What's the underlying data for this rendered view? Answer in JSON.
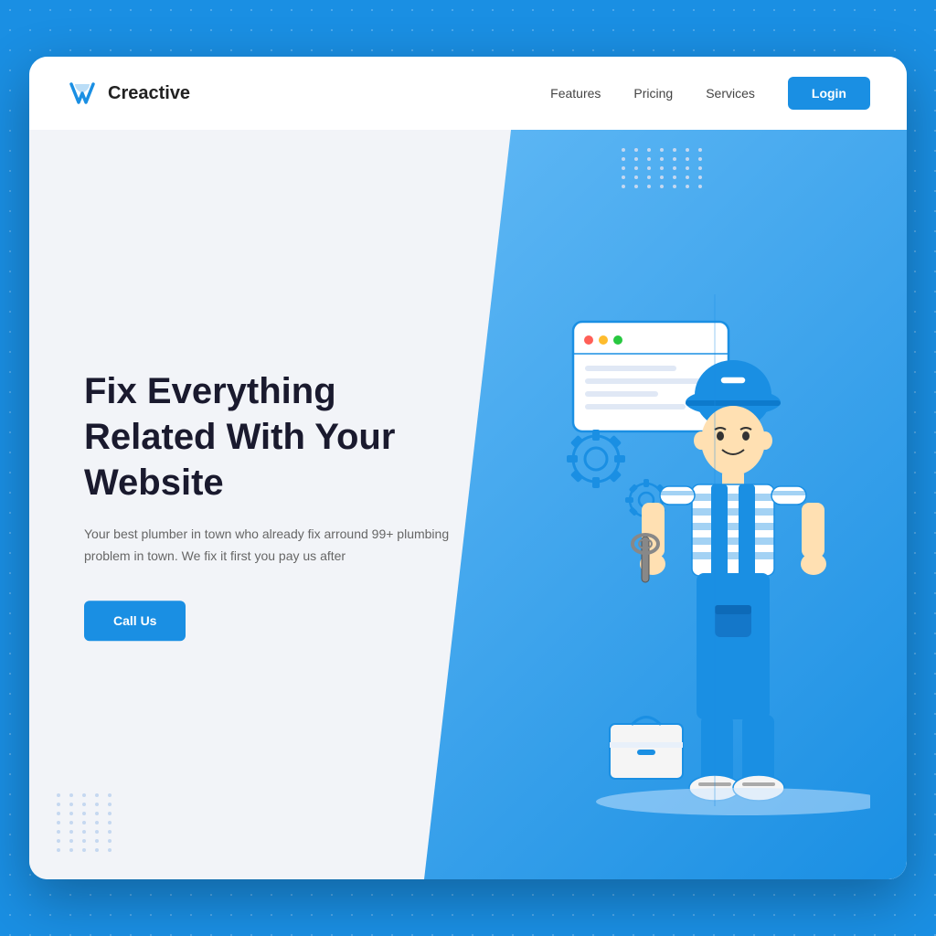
{
  "meta": {
    "background_color": "#1a8fe3"
  },
  "header": {
    "logo_text": "Creactive",
    "nav": {
      "items": [
        {
          "label": "Features",
          "id": "features"
        },
        {
          "label": "Pricing",
          "id": "pricing"
        },
        {
          "label": "Services",
          "id": "services"
        }
      ],
      "login_label": "Login"
    }
  },
  "hero": {
    "title": "Fix Everything Related With Your Website",
    "subtitle": "Your best plumber in town who already fix arround 99+ plumbing problem in town. We fix it first you pay us after",
    "cta_label": "Call Us"
  },
  "decoration": {
    "dots_count": 35
  }
}
